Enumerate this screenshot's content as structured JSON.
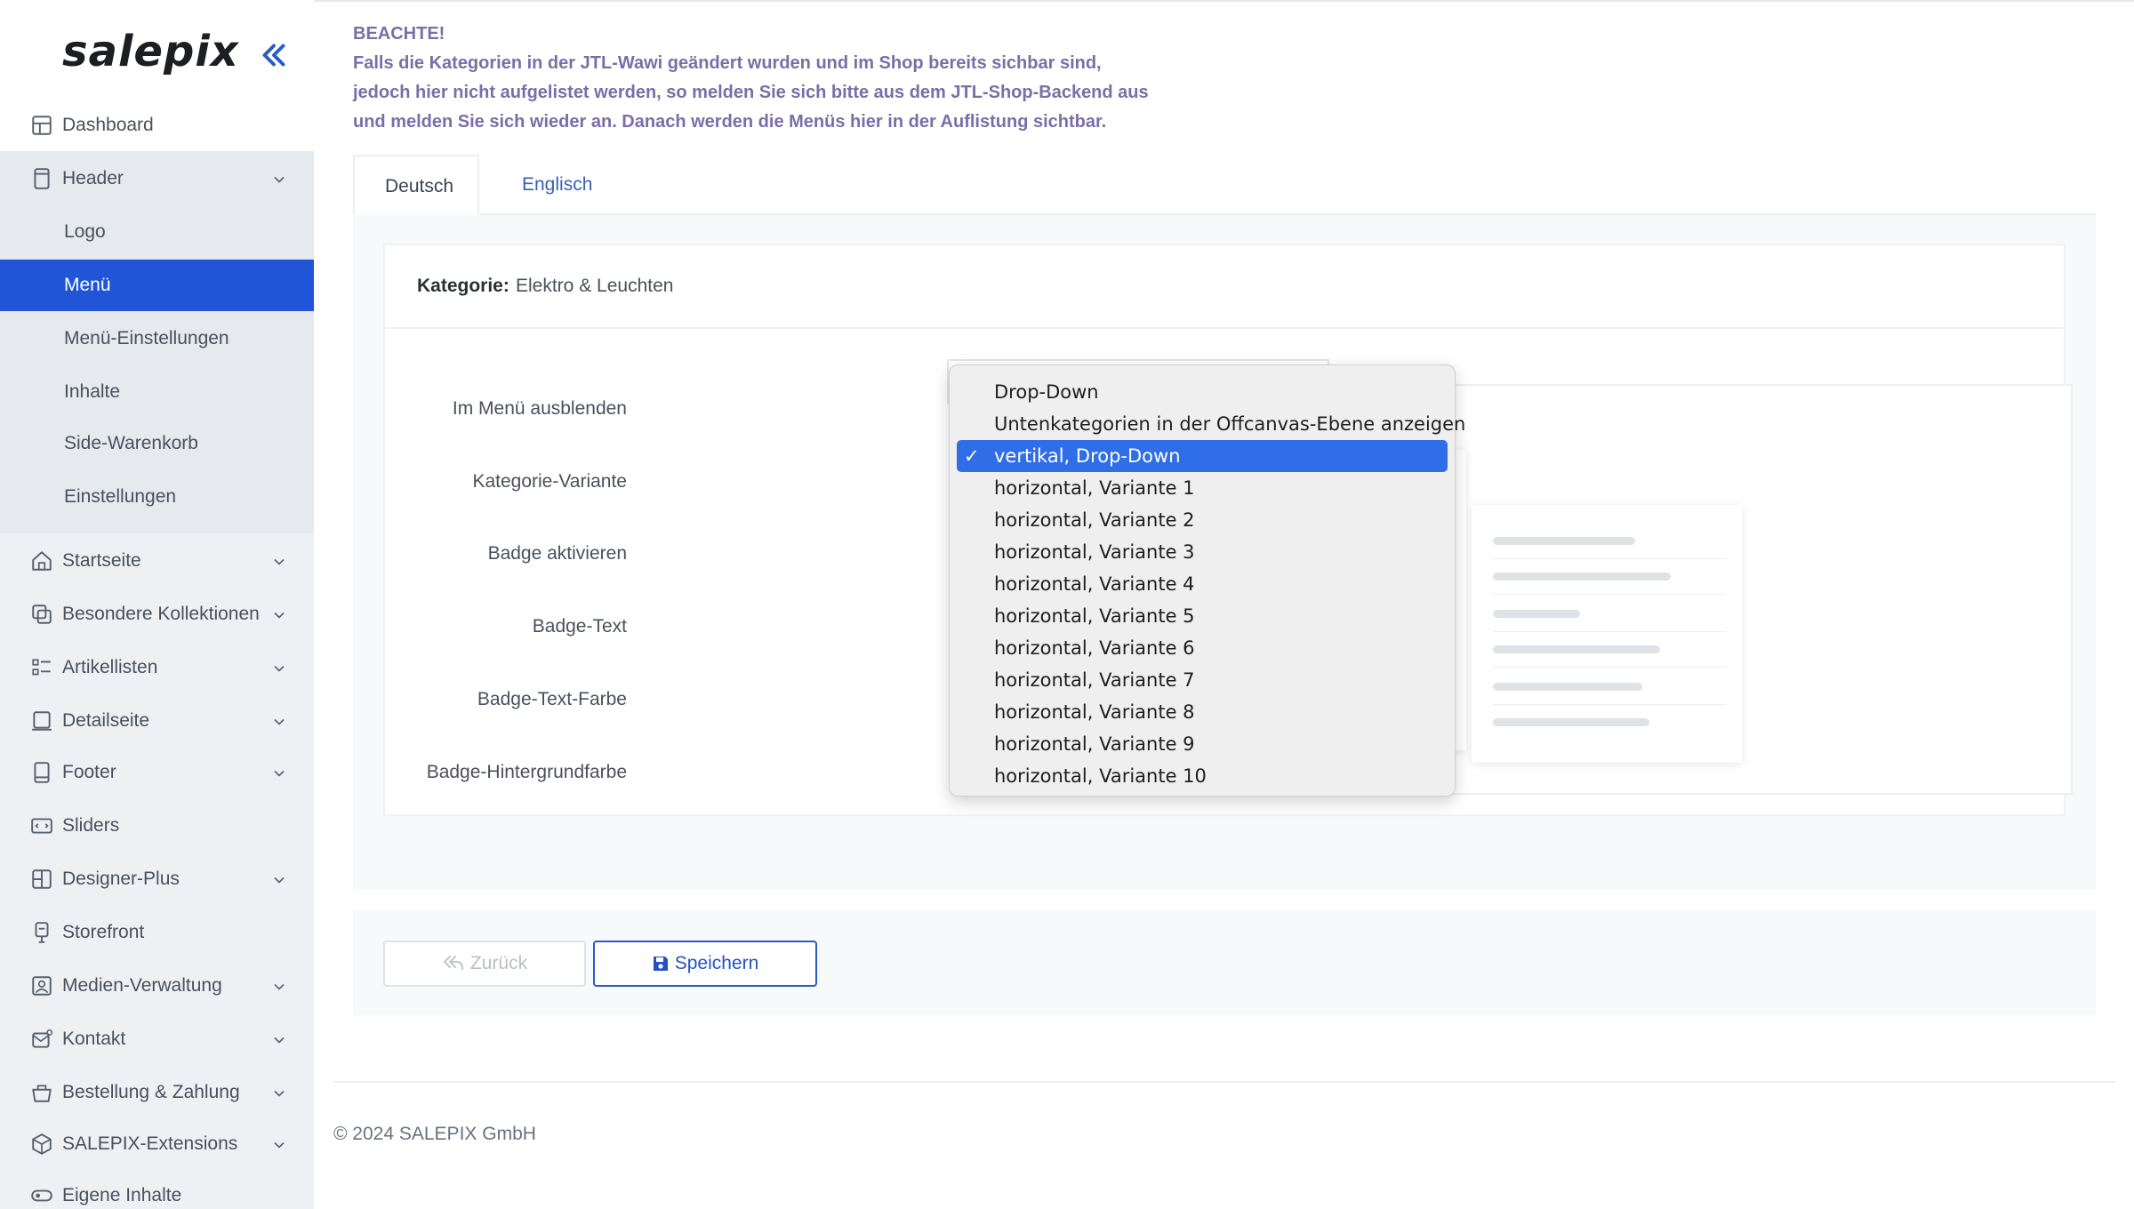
{
  "app": {
    "logo": "salepix"
  },
  "sidebar": {
    "items": [
      {
        "label": "Dashboard",
        "icon": "dashboard-icon"
      },
      {
        "label": "Header",
        "icon": "header-icon",
        "expandable": true,
        "expanded": true
      },
      {
        "label": "Logo"
      },
      {
        "label": "Menü",
        "active": true
      },
      {
        "label": "Menü-Einstellungen"
      },
      {
        "label": "Inhalte"
      },
      {
        "label": "Side-Warenkorb"
      },
      {
        "label": "Einstellungen"
      },
      {
        "label": "Startseite",
        "icon": "home-icon",
        "expandable": true
      },
      {
        "label": "Besondere Kollektionen",
        "icon": "collections-icon",
        "expandable": true
      },
      {
        "label": "Artikellisten",
        "icon": "list-icon",
        "expandable": true
      },
      {
        "label": "Detailseite",
        "icon": "detail-page-icon",
        "expandable": true
      },
      {
        "label": "Footer",
        "icon": "footer-icon",
        "expandable": true
      },
      {
        "label": "Sliders",
        "icon": "slider-icon"
      },
      {
        "label": "Designer-Plus",
        "icon": "designer-icon",
        "expandable": true
      },
      {
        "label": "Storefront",
        "icon": "storefront-icon"
      },
      {
        "label": "Medien-Verwaltung",
        "icon": "media-icon",
        "expandable": true
      },
      {
        "label": "Kontakt",
        "icon": "contact-icon",
        "expandable": true
      },
      {
        "label": "Bestellung & Zahlung",
        "icon": "order-icon",
        "expandable": true
      },
      {
        "label": "SALEPIX-Extensions",
        "icon": "extensions-icon",
        "expandable": true
      },
      {
        "label": "Eigene Inhalte",
        "icon": "custom-content-icon"
      }
    ]
  },
  "notice": {
    "heading": "BEACHTE!",
    "lines": [
      "Falls die Kategorien in der JTL-Wawi geändert wurden und im Shop bereits sichbar sind,",
      "jedoch hier nicht aufgelistet werden, so melden Sie sich bitte aus dem JTL-Shop-Backend aus",
      "und melden Sie sich wieder an. Danach werden die Menüs hier in der Auflistung sichtbar."
    ]
  },
  "tabs": [
    {
      "label": "Deutsch",
      "active": true
    },
    {
      "label": "Englisch"
    }
  ],
  "card": {
    "category_key": "Kategorie:",
    "category_value": "Elektro & Leuchten"
  },
  "form": {
    "labels": [
      "Im Menü ausblenden",
      "Kategorie-Variante",
      "Badge aktivieren",
      "Badge-Text",
      "Badge-Text-Farbe",
      "Badge-Hintergrundfarbe"
    ]
  },
  "dropdown": {
    "selected": "vertikal, Drop-Down",
    "check": "✓",
    "options": [
      "Drop-Down",
      "Untenkategorien in der Offcanvas-Ebene anzeigen",
      "vertikal, Drop-Down",
      "horizontal, Variante 1",
      "horizontal, Variante 2",
      "horizontal, Variante 3",
      "horizontal, Variante 4",
      "horizontal, Variante 5",
      "horizontal, Variante 6",
      "horizontal, Variante 7",
      "horizontal, Variante 8",
      "horizontal, Variante 9",
      "horizontal, Variante 10"
    ]
  },
  "buttons": {
    "back": "Zurück",
    "save": "Speichern"
  },
  "footer": {
    "copyright": "© 2024 SALEPIX GmbH"
  },
  "colors": {
    "accent": "#1f55d6",
    "notice": "#7a6ea8",
    "selected_option": "#2f6ee6"
  }
}
